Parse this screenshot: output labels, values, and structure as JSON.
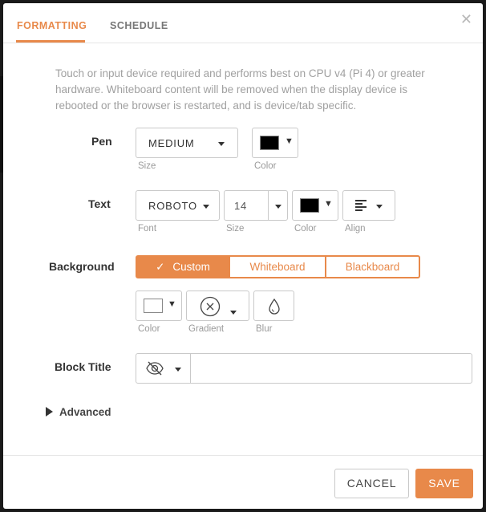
{
  "tabs": [
    {
      "label": "FORMATTING",
      "active": true
    },
    {
      "label": "SCHEDULE",
      "active": false
    }
  ],
  "close_icon": "close-icon",
  "intro_text": "Touch or input device required and performs best on CPU v4 (Pi 4) or greater hardware. Whiteboard content will be removed when the display device is rebooted or the browser is restarted, and is device/tab specific.",
  "pen": {
    "label": "Pen",
    "size_value": "MEDIUM",
    "size_caption": "Size",
    "color_value": "#000000",
    "color_caption": "Color"
  },
  "text": {
    "label": "Text",
    "font_value": "ROBOTO",
    "font_caption": "Font",
    "size_value": "14",
    "size_caption": "Size",
    "color_value": "#000000",
    "color_caption": "Color",
    "align_icon": "align-left-icon",
    "align_caption": "Align"
  },
  "background": {
    "label": "Background",
    "options": [
      "Custom",
      "Whiteboard",
      "Blackboard"
    ],
    "selected": "Custom",
    "color_value": "#ffffff",
    "color_caption": "Color",
    "gradient_caption": "Gradient",
    "blur_caption": "Blur"
  },
  "block_title": {
    "label": "Block Title",
    "visibility_icon": "eye-slash-icon",
    "value": ""
  },
  "advanced_label": "Advanced",
  "footer": {
    "cancel_label": "CANCEL",
    "save_label": "SAVE"
  },
  "colors": {
    "accent": "#e8894a",
    "muted_text": "#a0a0a0"
  }
}
